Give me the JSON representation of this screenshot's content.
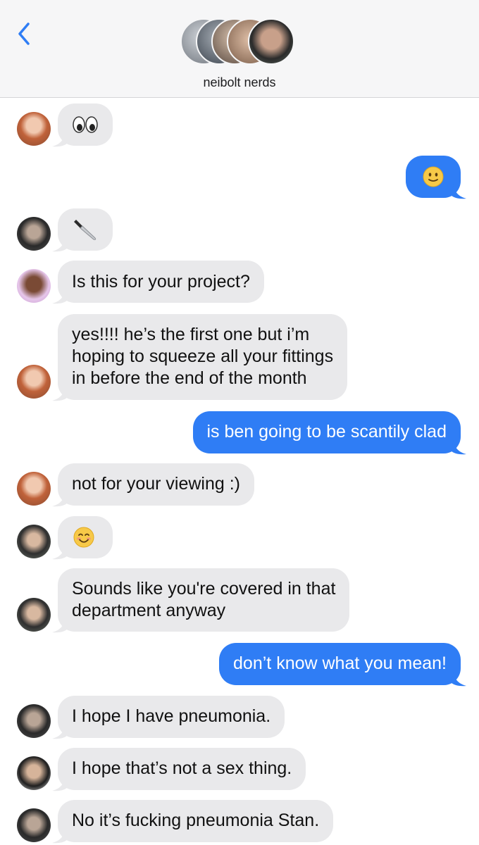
{
  "header": {
    "title": "neibolt nerds",
    "back_icon": "chevron-left-icon",
    "accent_color": "#2f7df5"
  },
  "messages": [
    {
      "side": "received",
      "sender_avatar": "avatar-redhead",
      "emoji": "eyes",
      "text": "👀"
    },
    {
      "side": "sent",
      "emoji": "slightly-smiling-face",
      "text": "🙂"
    },
    {
      "side": "received",
      "sender_avatar": "avatar-man-dark-hair",
      "emoji": "kitchen-knife",
      "text": "🔪"
    },
    {
      "side": "received",
      "sender_avatar": "avatar-woman-curly",
      "text": "Is this for your project?"
    },
    {
      "side": "received",
      "sender_avatar": "avatar-redhead",
      "lines": [
        "yes!!!! he’s the first one but i’m",
        "hoping to squeeze all your fittings",
        "in before the end of the month"
      ]
    },
    {
      "side": "sent",
      "text": "is ben going to be scantily clad"
    },
    {
      "side": "received",
      "sender_avatar": "avatar-redhead",
      "text": "not for your viewing :)"
    },
    {
      "side": "received",
      "sender_avatar": "avatar-man-smiling",
      "emoji": "smiling-face-with-smiling-eyes",
      "text": "😊"
    },
    {
      "side": "received",
      "sender_avatar": "avatar-man-smiling",
      "lines": [
        "Sounds like you're covered in that",
        "department anyway"
      ]
    },
    {
      "side": "sent",
      "text": "don’t know what you mean!"
    },
    {
      "side": "received",
      "sender_avatar": "avatar-man-dark-hair",
      "text": "I hope I have pneumonia."
    },
    {
      "side": "received",
      "sender_avatar": "avatar-man-curly",
      "text": "I hope that’s not a sex thing."
    },
    {
      "side": "received",
      "sender_avatar": "avatar-man-dark-hair",
      "text": "No it’s fucking pneumonia Stan."
    }
  ]
}
